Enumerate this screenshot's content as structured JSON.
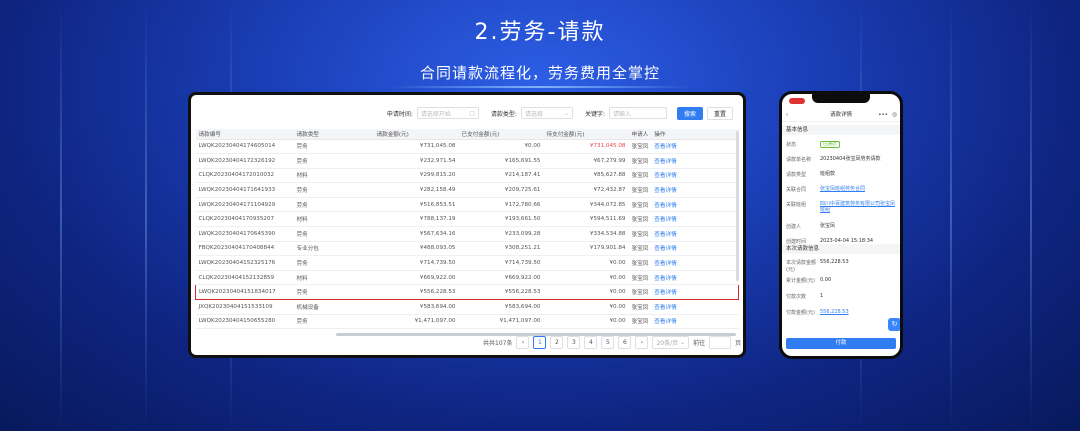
{
  "slide": {
    "title": "2.劳务-请款",
    "subtitle": "合同请款流程化，劳务费用全掌控"
  },
  "desktop": {
    "filters": {
      "apply_time_label": "申请时间:",
      "start_date_placeholder": "请选择开始",
      "type_label": "请款类型:",
      "type_placeholder": "请选择",
      "keyword_label": "关键字:",
      "keyword_placeholder": "请输入",
      "search_button": "搜索",
      "reset_button": "重置"
    },
    "columns": [
      "请款编号",
      "请款类型",
      "请款金额(元)",
      "已支付金额(元)",
      "待支付金额(元)",
      "申请人",
      "操作"
    ],
    "rows": [
      {
        "id": "LWQK20230404174605014",
        "type": "劳务",
        "amount": "¥731,045.08",
        "paid": "¥0.00",
        "pending": "¥731,045.08",
        "applicant": "张宝凤",
        "action": "查看详情",
        "pending_red": true
      },
      {
        "id": "LWQK20230404172326192",
        "type": "劳务",
        "amount": "¥232,971.54",
        "paid": "¥165,691.55",
        "pending": "¥67,279.99",
        "applicant": "张宝凤",
        "action": "查看详情"
      },
      {
        "id": "CLQK20230404172010032",
        "type": "材料",
        "amount": "¥299,815.20",
        "paid": "¥214,187.41",
        "pending": "¥85,627.88",
        "applicant": "张宝凤",
        "action": "查看详情"
      },
      {
        "id": "LWQK20230404171641933",
        "type": "劳务",
        "amount": "¥282,158.49",
        "paid": "¥209,725.61",
        "pending": "¥72,432.87",
        "applicant": "张宝凤",
        "action": "查看详情"
      },
      {
        "id": "LWQK20230404171104929",
        "type": "劳务",
        "amount": "¥516,853.51",
        "paid": "¥172,780.66",
        "pending": "¥344,072.85",
        "applicant": "张宝凤",
        "action": "查看详情"
      },
      {
        "id": "CLQK20230404170935207",
        "type": "材料",
        "amount": "¥788,137.19",
        "paid": "¥193,661.50",
        "pending": "¥594,511.69",
        "applicant": "张宝凤",
        "action": "查看详情"
      },
      {
        "id": "LWQK20230404170645390",
        "type": "劳务",
        "amount": "¥567,634.16",
        "paid": "¥233,099.28",
        "pending": "¥334,534.88",
        "applicant": "张宝凤",
        "action": "查看详情"
      },
      {
        "id": "FBQK20230404170408844",
        "type": "专业分包",
        "amount": "¥488,093.05",
        "paid": "¥308,251.21",
        "pending": "¥179,901.84",
        "applicant": "张宝凤",
        "action": "查看详情"
      },
      {
        "id": "LWQK20230404152325176",
        "type": "劳务",
        "amount": "¥714,739.50",
        "paid": "¥714,739.50",
        "pending": "¥0.00",
        "applicant": "张宝凤",
        "action": "查看详情"
      },
      {
        "id": "CLQK20230404152132859",
        "type": "材料",
        "amount": "¥669,922.00",
        "paid": "¥669,922.00",
        "pending": "¥0.00",
        "applicant": "张宝凤",
        "action": "查看详情"
      },
      {
        "id": "LWQK20230404151834017",
        "type": "劳务",
        "amount": "¥556,228.53",
        "paid": "¥556,228.53",
        "pending": "¥0.00",
        "applicant": "张宝凤",
        "action": "查看详情",
        "highlight": true
      },
      {
        "id": "JXQK20230404151533109",
        "type": "机械设备",
        "amount": "¥583,694.00",
        "paid": "¥583,694.00",
        "pending": "¥0.00",
        "applicant": "张宝凤",
        "action": "查看详情"
      },
      {
        "id": "LWQK20230404150655280",
        "type": "劳务",
        "amount": "¥1,471,097.00",
        "paid": "¥1,471,097.00",
        "pending": "¥0.00",
        "applicant": "张宝凤",
        "action": "查看详情"
      }
    ],
    "pager": {
      "total": "共共107条",
      "pages": [
        "1",
        "2",
        "3",
        "4",
        "5",
        "6"
      ],
      "active_page": "1",
      "page_size": "20条/页",
      "goto_label": "前往",
      "goto_suffix": "页"
    }
  },
  "phone": {
    "header_title": "请款详情",
    "back_icon": "‹",
    "section_basic": "基本信息",
    "fields": [
      {
        "label": "状态",
        "value": "已通过",
        "kind": "badge"
      },
      {
        "label": "请款单名称",
        "value": "20230404张宝凤劳务请款"
      },
      {
        "label": "请款类型",
        "value": "班组款"
      },
      {
        "label": "关联合同",
        "value": "张宝凤班组劳务合同",
        "kind": "link"
      },
      {
        "label": "关联班组",
        "value": "四川中百建筑劳务有限公司张宝凤班组",
        "kind": "link"
      },
      {
        "label": "创建人",
        "value": "张宝凤"
      },
      {
        "label": "创建时间",
        "value": "2023-04-04 15:18:34"
      }
    ],
    "section_pay": "本次请款信息",
    "pay_fields": [
      {
        "label": "本次请款金额(元)",
        "value": "556,228.53"
      },
      {
        "label": "累计金额(元)",
        "value": "0.00"
      },
      {
        "label": "付款次数",
        "value": "1"
      },
      {
        "label": "付款金额(元)",
        "value": "556,228.53",
        "kind": "link"
      }
    ],
    "bottom_button": "付款"
  }
}
